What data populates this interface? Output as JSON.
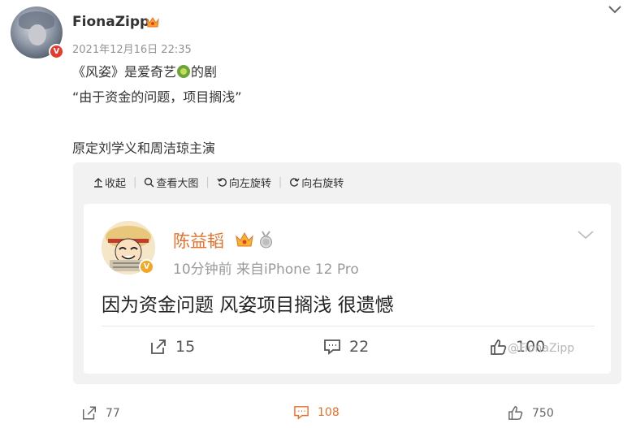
{
  "post": {
    "username": "FionaZipp",
    "timestamp": "2021年12月16日 22:35",
    "line1_a": "《风姿》是爱奇艺",
    "line1_b": "的剧",
    "line2": "“由于资金的问题，项目搁浅”",
    "line3": "原定刘学义和周洁琼主演",
    "verified_badge": "V"
  },
  "toolbar": {
    "collapse": "收起",
    "view_large": "查看大图",
    "rotate_left": "向左旋转",
    "rotate_right": "向右旋转"
  },
  "repost": {
    "username": "陈益韬",
    "meta": "10分钟前  来自iPhone 12 Pro",
    "text": "因为资金问题 风姿项目搁浅 很遗憾",
    "repost_count": "15",
    "comment_count": "22",
    "like_count": "100",
    "watermark": "@FionaZipp"
  },
  "actions": {
    "repost_count": "77",
    "comment_count": "108",
    "like_count": "750"
  },
  "colors": {
    "accent_orange": "#e8702a",
    "verified_red": "#e8392d",
    "panel_bg": "#f2f2f2"
  }
}
